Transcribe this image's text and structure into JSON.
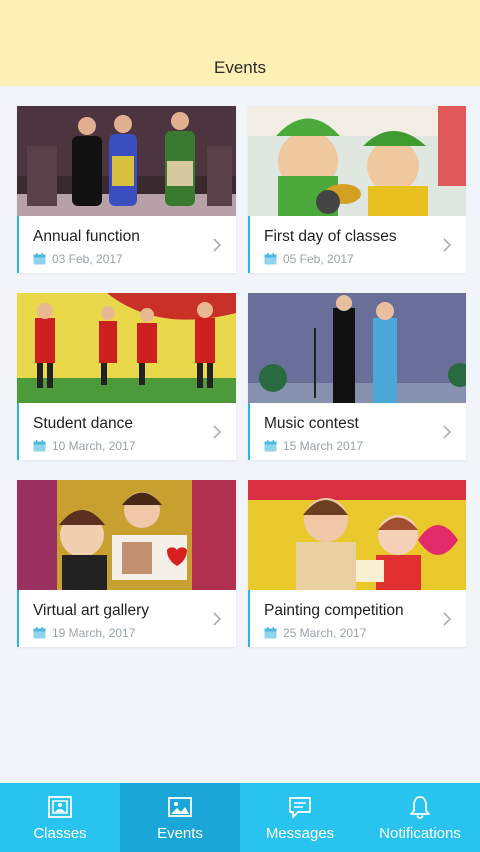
{
  "header": {
    "title": "Events"
  },
  "events": [
    {
      "title": "Annual function",
      "date": "03 Feb, 2017"
    },
    {
      "title": "First day of classes",
      "date": "05 Feb, 2017"
    },
    {
      "title": "Student dance",
      "date": "10 March, 2017"
    },
    {
      "title": "Music contest",
      "date": "15 March 2017"
    },
    {
      "title": "Virtual art gallery",
      "date": "19 March, 2017"
    },
    {
      "title": "Painting competition",
      "date": "25 March, 2017"
    }
  ],
  "nav": {
    "items": [
      {
        "label": "Classes",
        "icon": "picture-frame-icon"
      },
      {
        "label": "Events",
        "icon": "image-icon"
      },
      {
        "label": "Messages",
        "icon": "message-icon"
      },
      {
        "label": "Notifications",
        "icon": "bell-icon"
      }
    ],
    "active": "Events"
  },
  "colors": {
    "header_bg": "#fdf0b5",
    "accent": "#29c3ef",
    "nav_active": "#1aa6d6",
    "page_bg": "#f1f4f8"
  }
}
